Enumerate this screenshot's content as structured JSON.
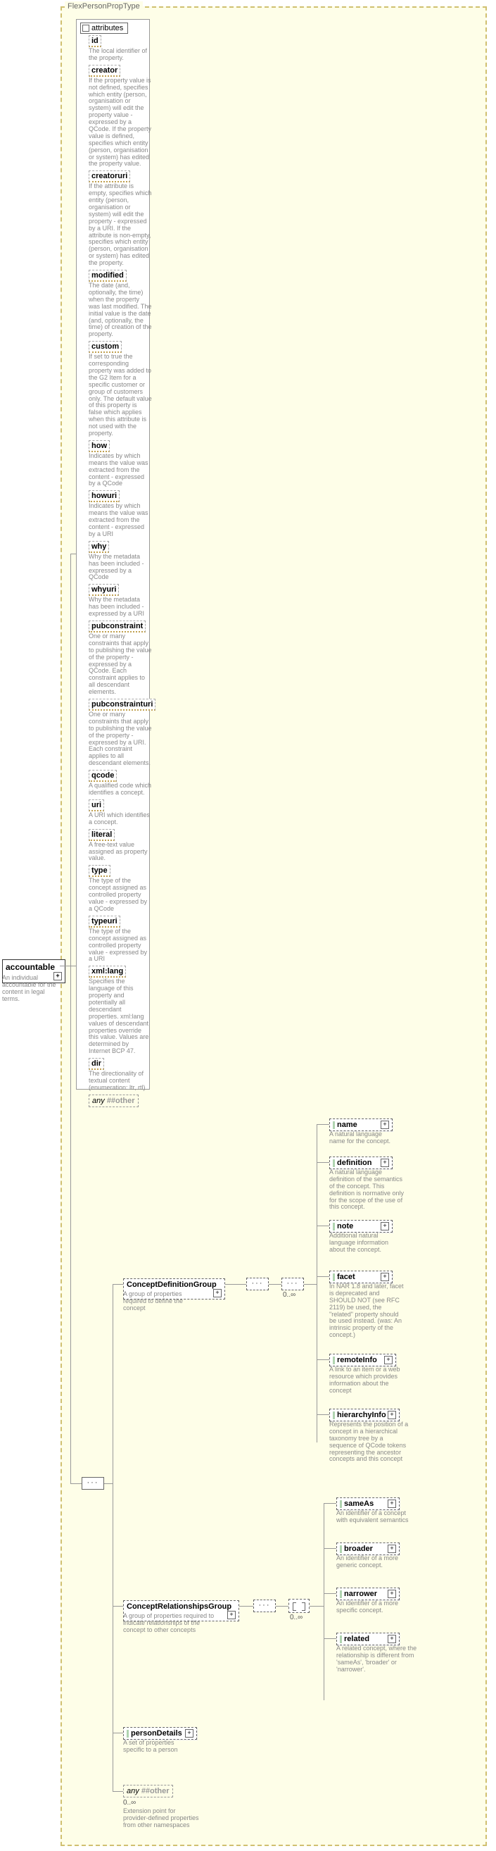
{
  "type": {
    "name": "FlexPersonPropType"
  },
  "root": {
    "label": "accountable",
    "desc": "An individual accountable for the content in legal terms."
  },
  "attributes_header": "attributes",
  "attributes": [
    {
      "name": "id",
      "desc": "The local identifier of the property."
    },
    {
      "name": "creator",
      "desc": "If the property value is not defined, specifies which entity (person, organisation or system) will edit the property value - expressed by a QCode. If the property value is defined, specifies which entity (person, organisation or system) has edited the property value."
    },
    {
      "name": "creatoruri",
      "desc": "If the attribute is empty, specifies which entity (person, organisation or system) will edit the property - expressed by a URI. If the attribute is non-empty, specifies which entity (person, organisation or system) has edited the property."
    },
    {
      "name": "modified",
      "desc": "The date (and, optionally, the time) when the property was last modified. The initial value is the date (and, optionally, the time) of creation of the property."
    },
    {
      "name": "custom",
      "desc": "If set to true the corresponding property was added to the G2 Item for a specific customer or group of customers only. The default value of this property is false which applies when this attribute is not used with the property."
    },
    {
      "name": "how",
      "desc": "Indicates by which means the value was extracted from the content - expressed by a QCode"
    },
    {
      "name": "howuri",
      "desc": "Indicates by which means the value was extracted from the content - expressed by a URI"
    },
    {
      "name": "why",
      "desc": "Why the metadata has been included - expressed by a QCode"
    },
    {
      "name": "whyuri",
      "desc": "Why the metadata has been included - expressed by a URI"
    },
    {
      "name": "pubconstraint",
      "desc": "One or many constraints that apply to publishing the value of the property - expressed by a QCode. Each constraint applies to all descendant elements."
    },
    {
      "name": "pubconstrainturi",
      "desc": "One or many constraints that apply to publishing the value of the property - expressed by a URI. Each constraint applies to all descendant elements."
    },
    {
      "name": "qcode",
      "desc": "A qualified code which identifies a concept."
    },
    {
      "name": "uri",
      "desc": "A URI which identifies a concept."
    },
    {
      "name": "literal",
      "desc": "A free-text value assigned as property value."
    },
    {
      "name": "type",
      "desc": "The type of the concept assigned as controlled property value - expressed by a QCode"
    },
    {
      "name": "typeuri",
      "desc": "The type of the concept assigned as controlled property value - expressed by a URI"
    },
    {
      "name": "xml:lang",
      "desc": "Specifies the language of this property and potentially all descendant properties. xml:lang values of descendant properties override this value. Values are determined by Internet BCP 47."
    },
    {
      "name": "dir",
      "desc": "The directionality of textual content (enumeration: ltr, rtl)"
    }
  ],
  "attr_any": {
    "kw": "any",
    "ns": "##other"
  },
  "groups": {
    "cdg": {
      "label": "ConceptDefinitionGroup",
      "desc": "A group of properties required to define the concept"
    },
    "crg": {
      "label": "ConceptRelationshipsGroup",
      "desc": "A group of properties required to indicate relationships of the concept to other concepts"
    },
    "pd": {
      "label": "personDetails",
      "desc": "A set of properties specific to a person"
    },
    "any": {
      "kw": "any",
      "ns": "##other",
      "mult": "0..∞",
      "desc": "Extension point for provider-defined properties from other namespaces"
    }
  },
  "defs": [
    {
      "label": "name",
      "desc": "A natural language name for the concept."
    },
    {
      "label": "definition",
      "desc": "A natural language definition of the semantics of the concept. This definition is normative only for the scope of the use of this concept."
    },
    {
      "label": "note",
      "desc": "Additional natural language information about the concept."
    },
    {
      "label": "facet",
      "desc": "In NAR 1.8 and later, facet is deprecated and SHOULD NOT (see RFC 2119) be used, the \"related\" property should be used instead. (was: An intrinsic property of the concept.)"
    },
    {
      "label": "remoteInfo",
      "desc": "A link to an item or a web resource which provides information about the concept"
    },
    {
      "label": "hierarchyInfo",
      "desc": "Represents the position of a concept in a hierarchical taxonomy tree by a sequence of QCode tokens representing the ancestor concepts and this concept"
    }
  ],
  "rels": [
    {
      "label": "sameAs",
      "desc": "An identifier of a concept with equivalent semantics"
    },
    {
      "label": "broader",
      "desc": "An identifier of a more generic concept."
    },
    {
      "label": "narrower",
      "desc": "An identifier of a more specific concept."
    },
    {
      "label": "related",
      "desc": "A related concept, where the relationship is different from 'sameAs', 'broader' or 'narrower'."
    }
  ],
  "mult_cdg": "0..∞",
  "mult_crg": "0..∞"
}
